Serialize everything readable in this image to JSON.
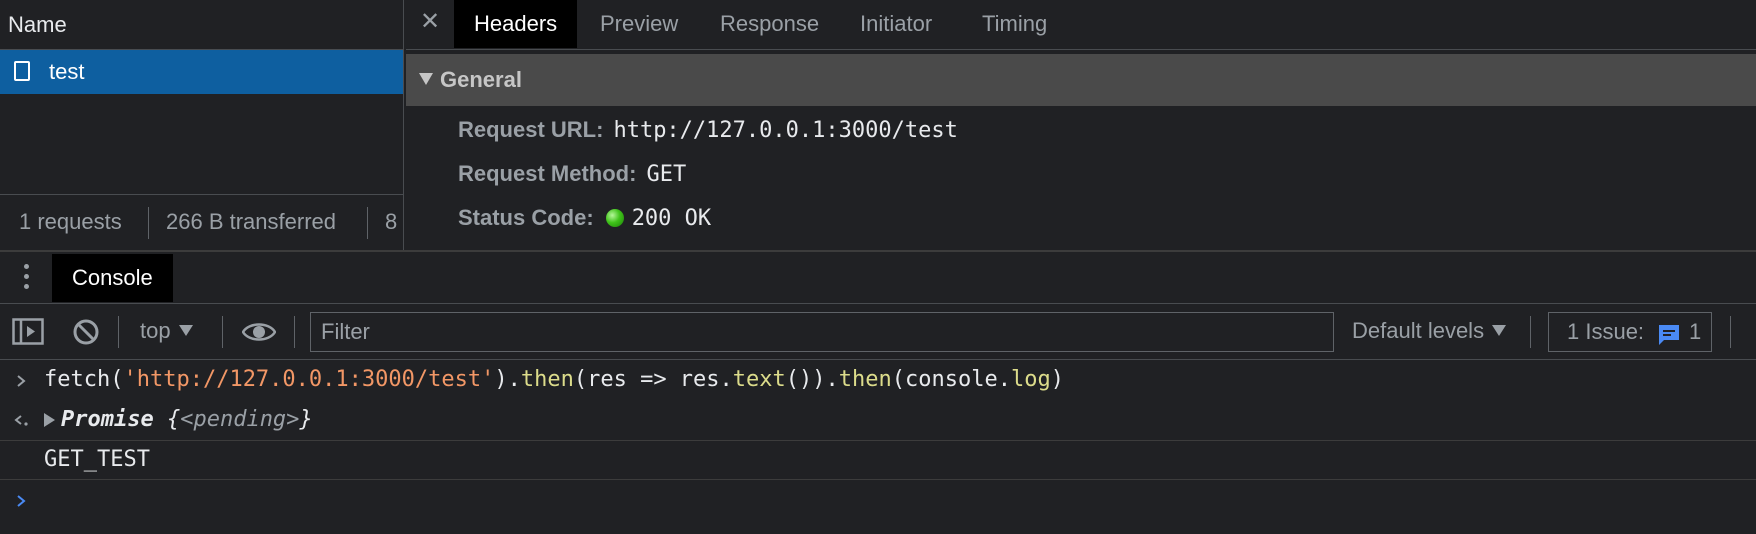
{
  "network": {
    "name_header": "Name",
    "request": {
      "name": "test"
    },
    "status": {
      "requests": "1 requests",
      "transferred": "266 B transferred",
      "extra": "8"
    }
  },
  "detail": {
    "tabs": [
      "Headers",
      "Preview",
      "Response",
      "Initiator",
      "Timing"
    ],
    "active_tab": "Headers",
    "section_title": "General",
    "rows": {
      "url": {
        "key": "Request URL:",
        "value": "http://127.0.0.1:3000/test"
      },
      "method": {
        "key": "Request Method:",
        "value": "GET"
      },
      "status": {
        "key": "Status Code:",
        "value": "200 OK",
        "dot_color": "#3fc31a"
      }
    }
  },
  "drawer": {
    "tab": "Console"
  },
  "toolbar": {
    "context": "top",
    "filter_placeholder": "Filter",
    "levels": "Default levels",
    "issues_label": "1 Issue:",
    "issues_count": "1"
  },
  "console": {
    "input": {
      "p1": "fetch(",
      "url": "'http://127.0.0.1:3000/test'",
      "p2": ").",
      "then1": "then",
      "p3": "(res => res.",
      "text": "text",
      "p4": "()).",
      "then2": "then",
      "p5": "(console.",
      "log": "log",
      "p6": ")"
    },
    "result": {
      "kind": "Promise",
      "open": " {",
      "state": "<pending>",
      "close": "}"
    },
    "log_output": "GET_TEST"
  },
  "colors": {
    "selected_row": "#0e5fa0",
    "accent_blue": "#4a8af4",
    "string": "#f29766"
  }
}
